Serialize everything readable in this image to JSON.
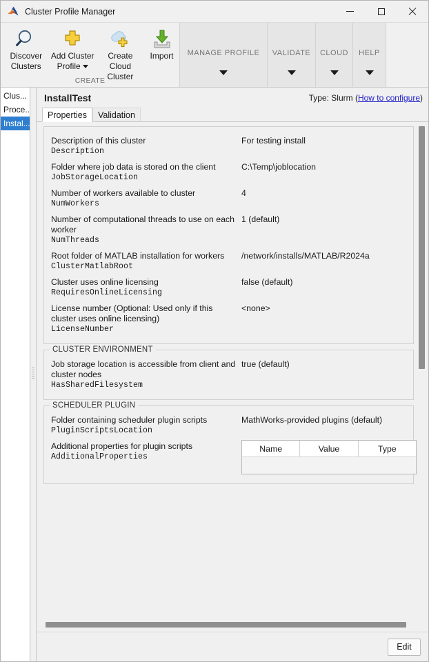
{
  "window": {
    "title": "Cluster Profile Manager",
    "logo_icon": "matlab-membrane-icon",
    "minimize_label": "—",
    "maximize_label": "□",
    "close_label": "✕"
  },
  "ribbon": {
    "create_group": {
      "label": "CREATE",
      "buttons": [
        {
          "id": "discover-clusters",
          "line1": "Discover",
          "line2": "Clusters",
          "icon": "magnifier-icon",
          "has_caret": false
        },
        {
          "id": "add-cluster-profile",
          "line1": "Add Cluster",
          "line2": "Profile",
          "icon": "yellow-plus-icon",
          "has_caret": true
        },
        {
          "id": "create-cloud-cluster",
          "line1": "Create Cloud",
          "line2": "Cluster",
          "icon": "cloud-plus-icon",
          "has_caret": false
        },
        {
          "id": "import",
          "line1": "Import",
          "line2": "",
          "icon": "green-download-icon",
          "has_caret": false
        }
      ]
    },
    "collapsed_groups": [
      {
        "id": "manage-profile",
        "label": "MANAGE PROFILE"
      },
      {
        "id": "validate",
        "label": "VALIDATE"
      },
      {
        "id": "cloud",
        "label": "CLOUD"
      },
      {
        "id": "help",
        "label": "HELP"
      }
    ]
  },
  "profile_list": {
    "items": [
      {
        "label": "Clus...",
        "selected": false
      },
      {
        "label": "Proce...",
        "selected": false
      },
      {
        "label": "Instal...",
        "selected": true
      }
    ],
    "selection_color": "#2f7fd1"
  },
  "pane": {
    "title": "InstallTest",
    "type_prefix": "Type: Slurm (",
    "type_link": "How to configure",
    "type_suffix": ")",
    "tabs": [
      {
        "label": "Properties",
        "active": true
      },
      {
        "label": "Validation",
        "active": false
      }
    ]
  },
  "properties": {
    "main_rows": [
      {
        "desc": "Description of this cluster",
        "code": "Description",
        "value": "For testing install"
      },
      {
        "desc": "Folder where job data is stored on the client",
        "code": "JobStorageLocation",
        "value": "C:\\Temp\\joblocation"
      },
      {
        "desc": "Number of workers available to cluster",
        "code": "NumWorkers",
        "value": "4"
      },
      {
        "desc": "Number of computational threads to use on each worker",
        "code": "NumThreads",
        "value": "1 (default)"
      },
      {
        "desc": "Root folder of MATLAB installation for workers",
        "code": "ClusterMatlabRoot",
        "value": "/network/installs/MATLAB/R2024a"
      },
      {
        "desc": "Cluster uses online licensing",
        "code": "RequiresOnlineLicensing",
        "value": "false (default)"
      },
      {
        "desc": "License number (Optional: Used only if this cluster uses online licensing)",
        "code": "LicenseNumber",
        "value": "<none>"
      }
    ],
    "cluster_environment": {
      "title": "CLUSTER ENVIRONMENT",
      "rows": [
        {
          "desc": "Job storage location is accessible from client and cluster nodes",
          "code": "HasSharedFilesystem",
          "value": "true (default)"
        }
      ]
    },
    "scheduler_plugin": {
      "title": "SCHEDULER PLUGIN",
      "rows": [
        {
          "desc": "Folder containing scheduler plugin scripts",
          "code": "PluginScriptsLocation",
          "value": "MathWorks-provided plugins (default)"
        }
      ],
      "additional_properties": {
        "desc": "Additional properties for plugin scripts",
        "code": "AdditionalProperties",
        "columns": [
          "Name",
          "Value",
          "Type"
        ],
        "rows": []
      }
    }
  },
  "footer": {
    "edit_label": "Edit"
  }
}
